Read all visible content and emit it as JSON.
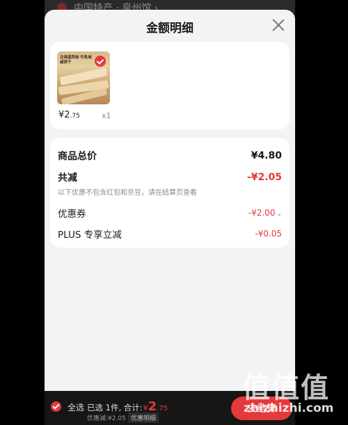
{
  "background": {
    "header_text": "中国特产 · 泉州馆 ›"
  },
  "sheet": {
    "title": "金额明细",
    "close_icon": "close-icon"
  },
  "product": {
    "image_text": "北海道风味 牛乳味咸饼干",
    "price_symbol": "¥",
    "price_int": "2",
    "price_dec": ".75",
    "quantity": "x1"
  },
  "summary": {
    "total_label": "商品总价",
    "total_value": "¥4.80",
    "reduce_label": "共减",
    "reduce_value": "-¥2.05",
    "note": "以下优惠不包含红包和京豆，请在结算页查看",
    "coupon_label": "优惠券",
    "coupon_value": "-¥2.00",
    "plus_label": "PLUS 专享立减",
    "plus_value": "-¥0.05"
  },
  "bottom_bar": {
    "select_all": "全选",
    "selected_text": "已选 1件, 合计:",
    "currency": "¥",
    "amount_int": "2",
    "amount_dec": ".75",
    "discount_text": "优惠减:¥2.05",
    "detail_button": "优惠明细",
    "checkout_button": "去结算"
  },
  "watermark": {
    "big": "值值值",
    "small": "zhizhizhi.com"
  },
  "colors": {
    "accent": "#e4393c",
    "sheet_bg": "#f3f3f3",
    "card_bg": "#ffffff",
    "bottom_bg": "#161616"
  }
}
